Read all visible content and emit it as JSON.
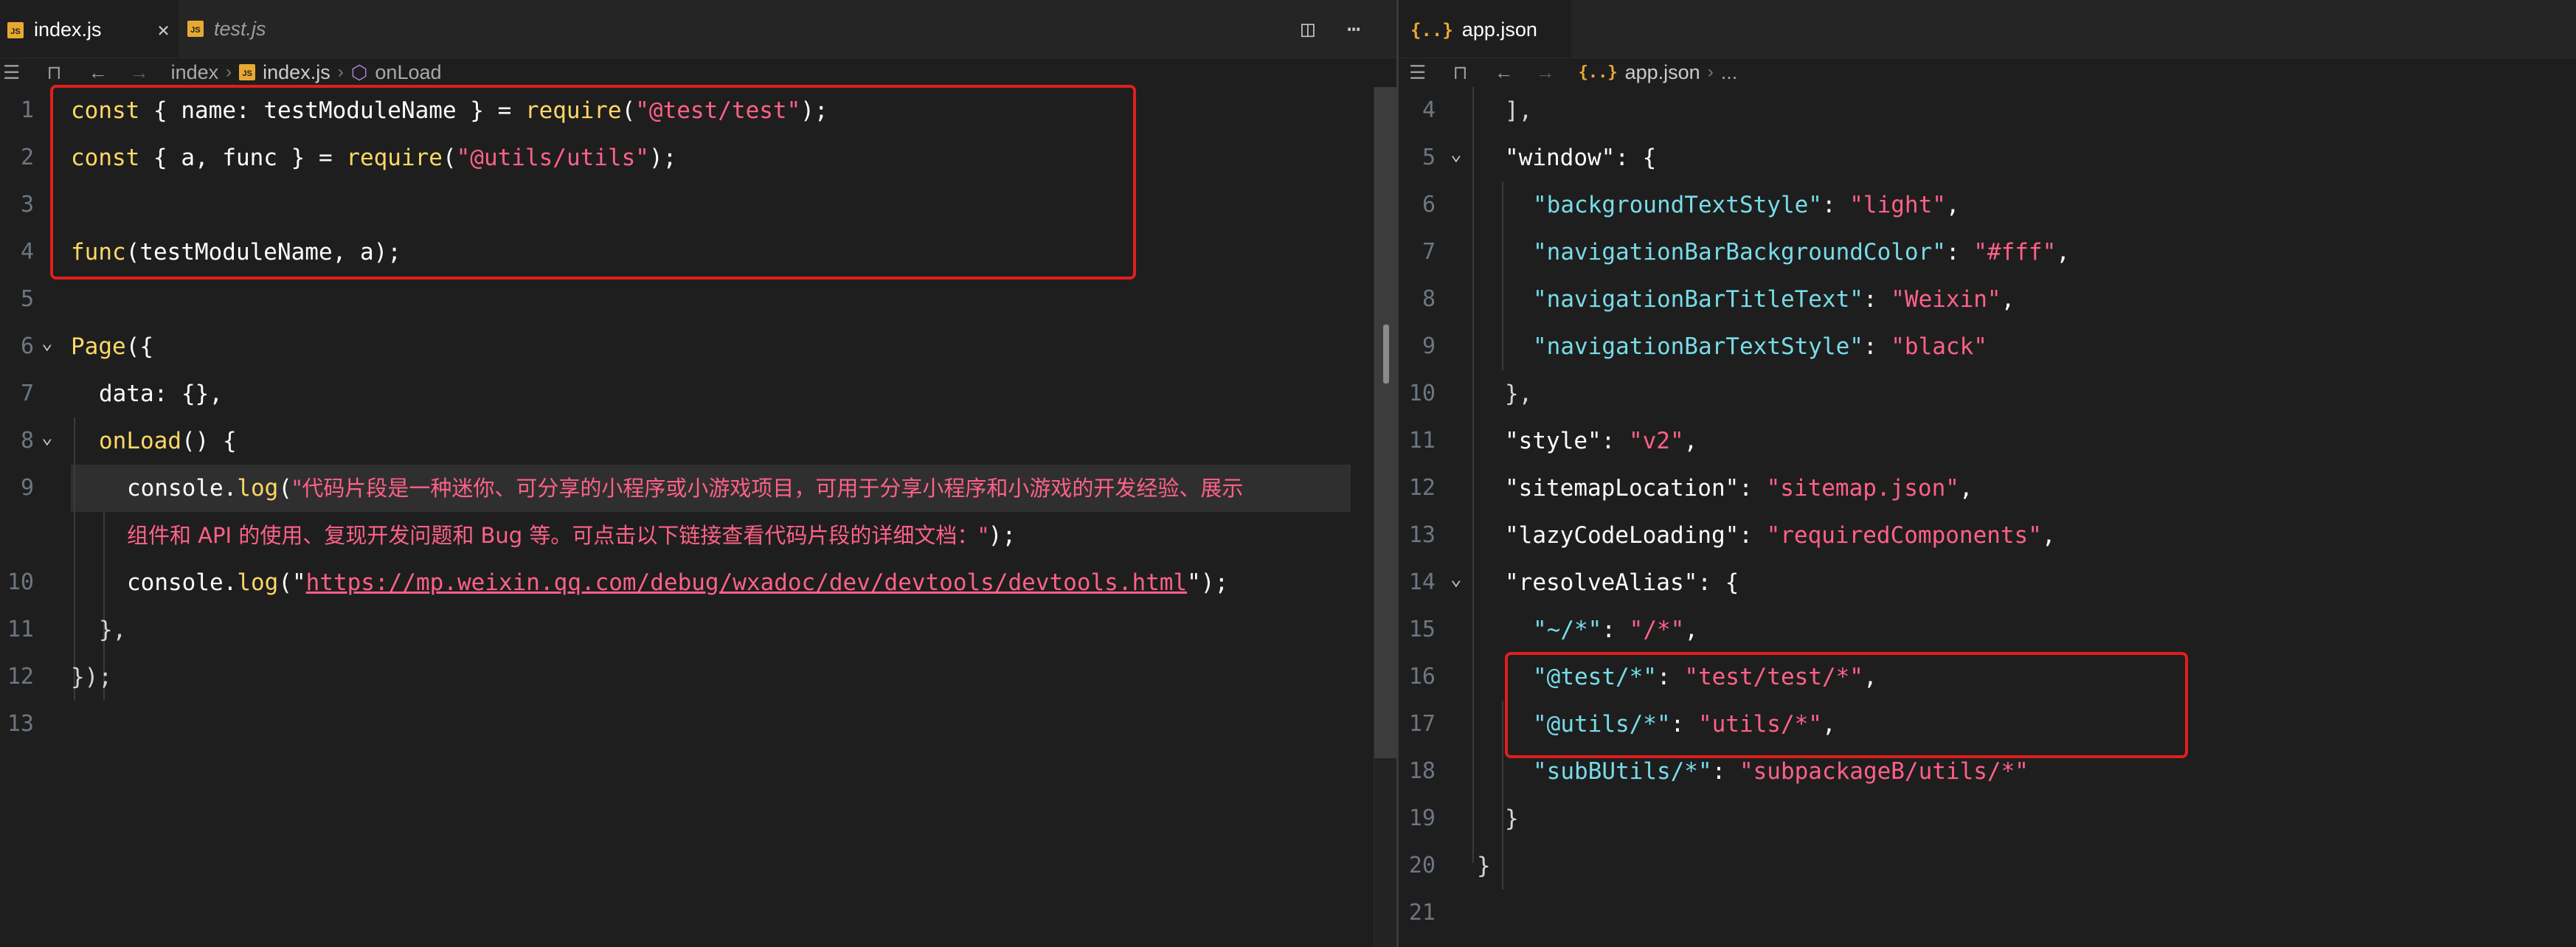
{
  "left": {
    "tabs": [
      {
        "label": "index.js",
        "active": true,
        "close": "×"
      },
      {
        "label": "test.js",
        "active": false
      }
    ],
    "breadcrumb": [
      "index",
      "index.js",
      "onLoad"
    ],
    "lines": [
      {
        "n": "1"
      },
      {
        "n": "2"
      },
      {
        "n": "3"
      },
      {
        "n": "4"
      },
      {
        "n": "5"
      },
      {
        "n": "6"
      },
      {
        "n": "7"
      },
      {
        "n": "8"
      },
      {
        "n": "9"
      },
      {
        "n": ""
      },
      {
        "n": "10"
      },
      {
        "n": "11"
      },
      {
        "n": "12"
      },
      {
        "n": "13"
      }
    ],
    "code": {
      "l1": {
        "kw": "const",
        "a": " { ",
        "b": "name",
        "c": ": ",
        "d": "testModuleName",
        "e": " } = ",
        "f": "require",
        "g": "(",
        "h": "\"@test/test\"",
        "i": ");"
      },
      "l2": {
        "kw": "const",
        "a": " { ",
        "b": "a",
        "c": ", ",
        "d": "func",
        "e": " } = ",
        "f": "require",
        "g": "(",
        "h": "\"@utils/utils\"",
        "i": ");"
      },
      "l4": {
        "f": "func",
        "a": "(",
        "b": "testModuleName",
        "c": ", ",
        "d": "a",
        "e": ");"
      },
      "l6": {
        "f": "Page",
        "a": "({"
      },
      "l7": {
        "k": "data",
        "a": ": ",
        "b": "{}",
        "c": ","
      },
      "l8": {
        "f": "onLoad",
        "a": "() {"
      },
      "l9": {
        "obj": "console",
        "dot": ".",
        "m": "log",
        "p": "(",
        "s": "\"代码片段是一种迷你、可分享的小程序或小游戏项目，可用于分享小程序和小游戏的开发经验、展示"
      },
      "l9b": {
        "s": "组件和 API 的使用、复现开发问题和 Bug 等。可点击以下链接查看代码片段的详细文档：\"",
        "e": ");"
      },
      "l10": {
        "obj": "console",
        "dot": ".",
        "m": "log",
        "p": "(\"",
        "url": "https://mp.weixin.qq.com/debug/wxadoc/dev/devtools/devtools.html",
        "e": "\");"
      },
      "l11": {
        "a": "},"
      },
      "l12": {
        "a": "});"
      }
    }
  },
  "right": {
    "tabs": [
      {
        "label": "app.json",
        "active": true
      }
    ],
    "breadcrumb": [
      "app.json",
      "..."
    ],
    "lines": [
      {
        "n": "4",
        "t": "],"
      },
      {
        "n": "5",
        "k": "\"window\"",
        "v": ": {"
      },
      {
        "n": "6",
        "k": "\"backgroundTextStyle\"",
        "c": ": ",
        "s": "\"light\"",
        "e": ","
      },
      {
        "n": "7",
        "k": "\"navigationBarBackgroundColor\"",
        "c": ": ",
        "s": "\"#fff\"",
        "e": ","
      },
      {
        "n": "8",
        "k": "\"navigationBarTitleText\"",
        "c": ": ",
        "s": "\"Weixin\"",
        "e": ","
      },
      {
        "n": "9",
        "k": "\"navigationBarTextStyle\"",
        "c": ": ",
        "s": "\"black\"",
        "e": ""
      },
      {
        "n": "10",
        "t": "},"
      },
      {
        "n": "11",
        "k": "\"style\"",
        "c": ": ",
        "s": "\"v2\"",
        "e": ","
      },
      {
        "n": "12",
        "k": "\"sitemapLocation\"",
        "c": ": ",
        "s": "\"sitemap.json\"",
        "e": ","
      },
      {
        "n": "13",
        "k": "\"lazyCodeLoading\"",
        "c": ": ",
        "s": "\"requiredComponents\"",
        "e": ","
      },
      {
        "n": "14",
        "k": "\"resolveAlias\"",
        "v": ": {"
      },
      {
        "n": "15",
        "k": "\"~/*\"",
        "c": ": ",
        "s": "\"/*\"",
        "e": ","
      },
      {
        "n": "16",
        "k": "\"@test/*\"",
        "c": ": ",
        "s": "\"test/test/*\"",
        "e": ","
      },
      {
        "n": "17",
        "k": "\"@utils/*\"",
        "c": ": ",
        "s": "\"utils/*\"",
        "e": ","
      },
      {
        "n": "18",
        "k": "\"subBUtils/*\"",
        "c": ": ",
        "s": "\"subpackageB/utils/*\"",
        "e": ""
      },
      {
        "n": "19",
        "t": "}"
      },
      {
        "n": "20",
        "t": "}"
      },
      {
        "n": "21",
        "t": ""
      }
    ]
  },
  "colors": {
    "annotation": "#e01e1e",
    "background": "#1e1e1e"
  }
}
